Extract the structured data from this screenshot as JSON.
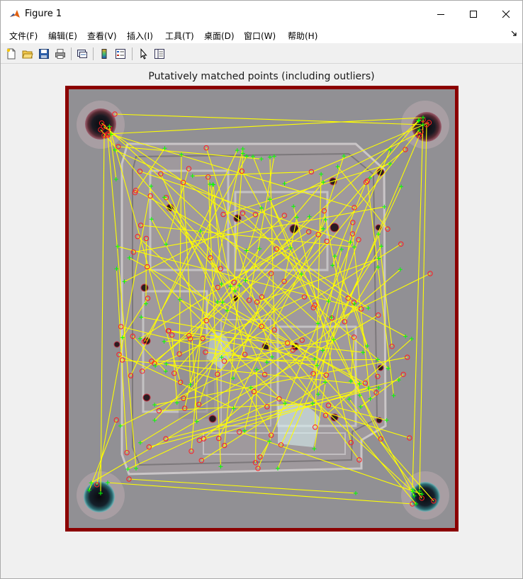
{
  "window": {
    "title": "Figure 1",
    "controls": [
      "minimize",
      "maximize",
      "close"
    ]
  },
  "menu": {
    "items": [
      {
        "label": "文件(F)"
      },
      {
        "label": "编辑(E)"
      },
      {
        "label": "查看(V)"
      },
      {
        "label": "插入(I)"
      },
      {
        "label": "工具(T)"
      },
      {
        "label": "桌面(D)"
      },
      {
        "label": "窗口(W)"
      },
      {
        "label": "帮助(H)"
      }
    ]
  },
  "toolbar": {
    "buttons": [
      "new-figure-icon",
      "open-file-icon",
      "save-icon",
      "print-icon",
      "link-plot-icon",
      "colorbar-icon",
      "legend-icon",
      "edit-plot-arrow-icon",
      "property-inspector-icon"
    ]
  },
  "figure": {
    "title": "Putatively matched points (including outliers)"
  },
  "colors": {
    "match_line": "#ffff00",
    "points_image1": "#ff2020",
    "points_image2": "#00ff00",
    "frame": "#8b0000"
  }
}
